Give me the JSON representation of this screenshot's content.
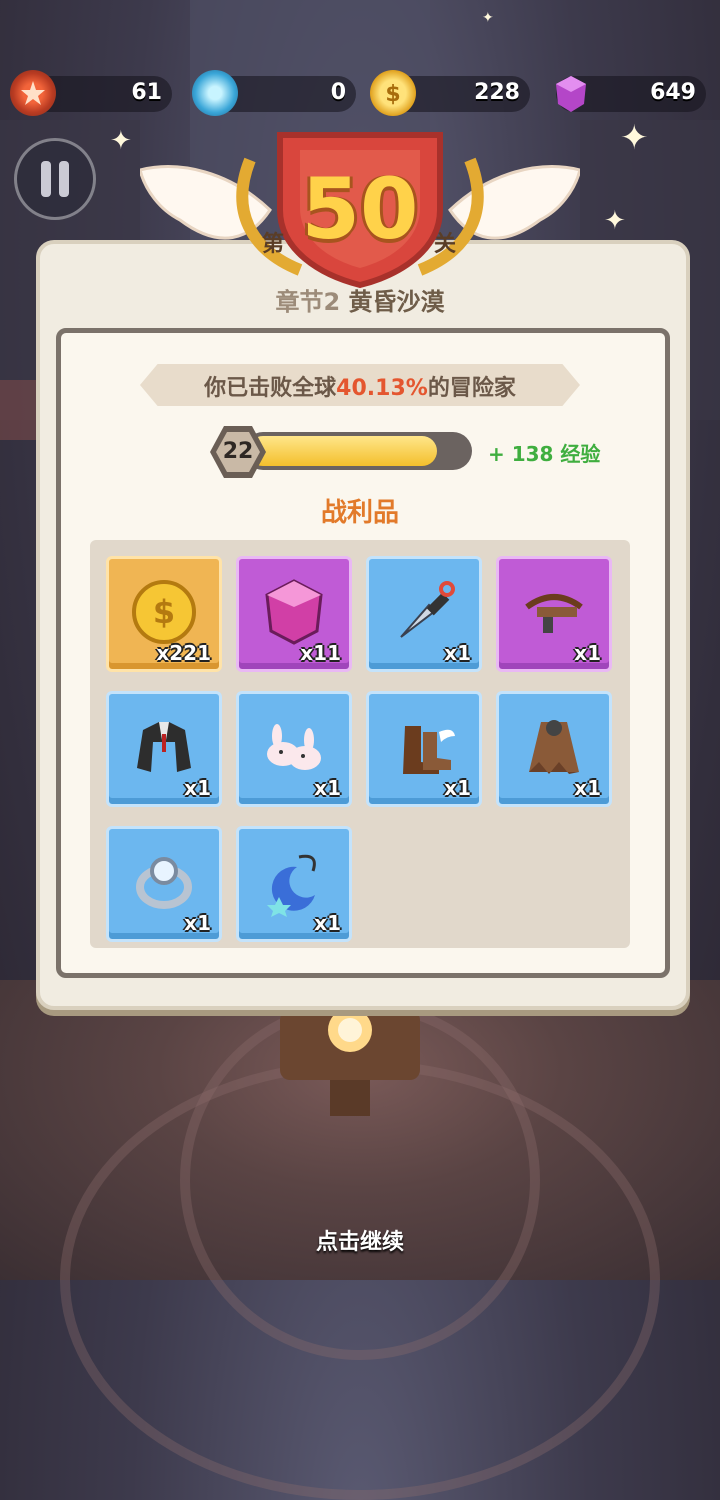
{
  "resources": [
    {
      "icon": "medal-icon",
      "value": "61"
    },
    {
      "icon": "energy-icon",
      "value": "0"
    },
    {
      "icon": "coin-icon",
      "value": "228"
    },
    {
      "icon": "gem-icon",
      "value": "649"
    }
  ],
  "banner": {
    "prefix": "第",
    "level": "50",
    "suffix": "关"
  },
  "chapter": {
    "number": "章节2",
    "name": "黄昏沙漠"
  },
  "ranking": {
    "before": "你已击败全球",
    "percent": "40.13%",
    "after": "的冒险家"
  },
  "player_level": "22",
  "xp_progress_percent": 86,
  "xp_gain": "+ 138 经验",
  "loot_title": "战利品",
  "loot": [
    {
      "icon": "gold-coin-icon",
      "qty": "x221",
      "rarity": "gold"
    },
    {
      "icon": "purple-gem-icon",
      "qty": "x11",
      "rarity": "purple"
    },
    {
      "icon": "kunai-icon",
      "qty": "x1",
      "rarity": "blue"
    },
    {
      "icon": "crossbow-icon",
      "qty": "x1",
      "rarity": "purple"
    },
    {
      "icon": "jacket-icon",
      "qty": "x1",
      "rarity": "blue"
    },
    {
      "icon": "bunny-slippers-icon",
      "qty": "x1",
      "rarity": "blue"
    },
    {
      "icon": "winged-boots-icon",
      "qty": "x1",
      "rarity": "blue"
    },
    {
      "icon": "cloak-icon",
      "qty": "x1",
      "rarity": "blue"
    },
    {
      "icon": "bracelet-icon",
      "qty": "x1",
      "rarity": "blue"
    },
    {
      "icon": "moon-amulet-icon",
      "qty": "x1",
      "rarity": "blue"
    }
  ],
  "continue_text": "点击继续",
  "colors": {
    "accent": "#e27a2a",
    "highlight": "#e4562f",
    "xp_green": "#3fae3f"
  }
}
